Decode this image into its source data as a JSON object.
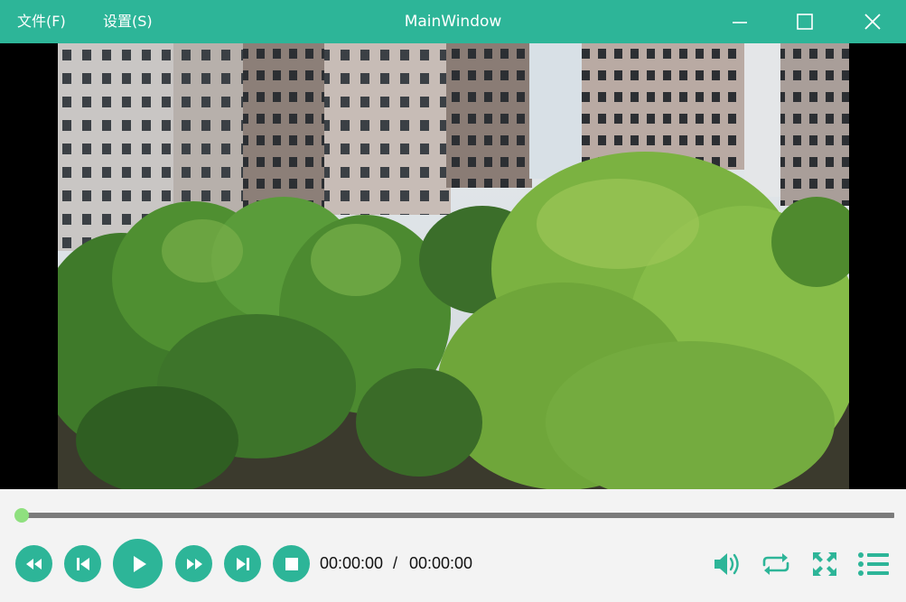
{
  "window": {
    "title": "MainWindow",
    "menus": [
      {
        "label": "文件(F)"
      },
      {
        "label": "设置(S)"
      }
    ],
    "accent_color": "#2db598"
  },
  "player": {
    "progress_fraction": 0.0,
    "time_current": "00:00:00",
    "time_separator": "/",
    "time_total": "00:00:00"
  },
  "controls": {
    "icons": [
      "rewind-icon",
      "previous-icon",
      "play-icon",
      "fast-forward-icon",
      "next-icon",
      "stop-icon",
      "volume-icon",
      "loop-icon",
      "fullscreen-icon",
      "playlist-icon"
    ]
  }
}
